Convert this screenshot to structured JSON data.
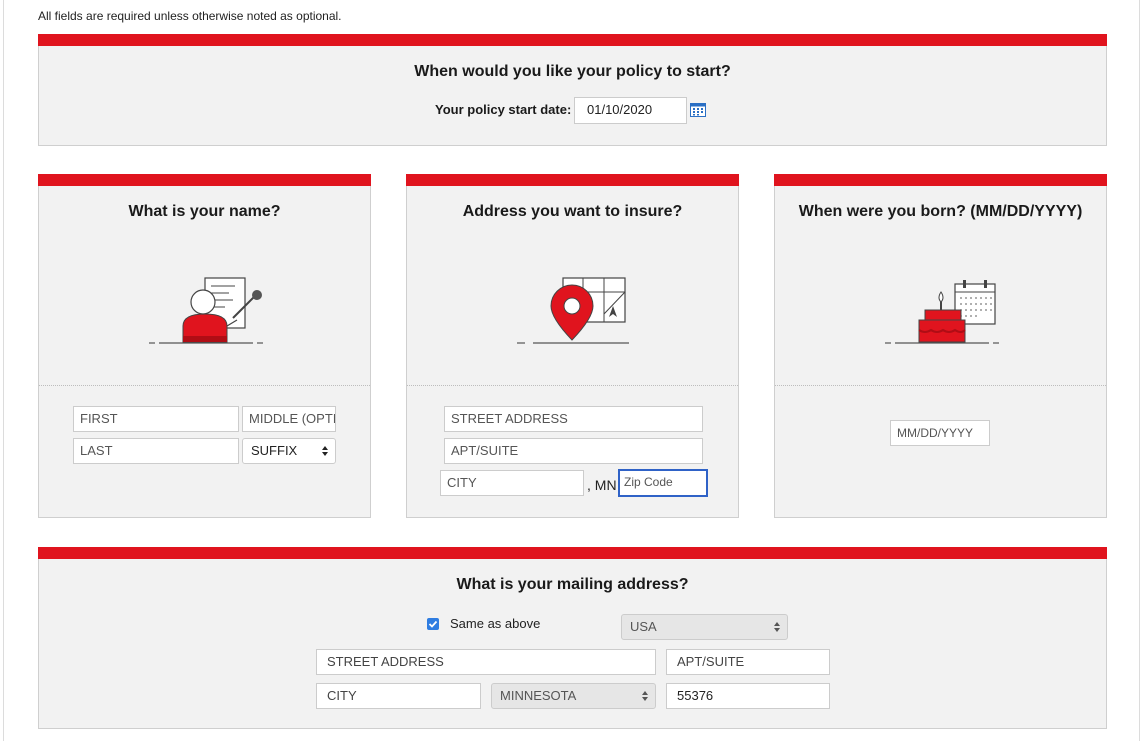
{
  "note": "All fields are required unless otherwise noted as optional.",
  "policy": {
    "title": "When would you like your policy to start?",
    "start_label": "Your policy start date:",
    "start_value": "01/10/2020"
  },
  "name": {
    "title": "What is your name?",
    "first_placeholder": "FIRST",
    "middle_placeholder": "MIDDLE (OPTIONAL)",
    "last_placeholder": "LAST",
    "suffix_selected": "SUFFIX"
  },
  "address": {
    "title": "Address you want to insure?",
    "street_placeholder": "STREET ADDRESS",
    "apt_placeholder": "APT/SUITE",
    "city_placeholder": "CITY",
    "state_text": ", MN",
    "zip_placeholder": "Zip Code"
  },
  "birth": {
    "title": "When were you born? (MM/DD/YYYY)",
    "dob_placeholder": "MM/DD/YYYY"
  },
  "mailing": {
    "title": "What is your mailing address?",
    "same_as_above_label": "Same as above",
    "same_as_above_checked": true,
    "country_selected": "USA",
    "street_placeholder": "STREET ADDRESS",
    "apt_placeholder": "APT/SUITE",
    "city_placeholder": "CITY",
    "state_selected": "MINNESOTA",
    "zip_value": "55376"
  },
  "colors": {
    "accent_red": "#e0141e",
    "panel_bg": "#f2f2f2",
    "focus_blue": "#2f62c7",
    "checkbox_blue": "#2f7de1"
  },
  "icons": {
    "calendar": "calendar-icon",
    "name_illustration": "person-signing-document-icon",
    "address_illustration": "map-pin-icon",
    "birth_illustration": "birthday-cake-calendar-icon"
  }
}
